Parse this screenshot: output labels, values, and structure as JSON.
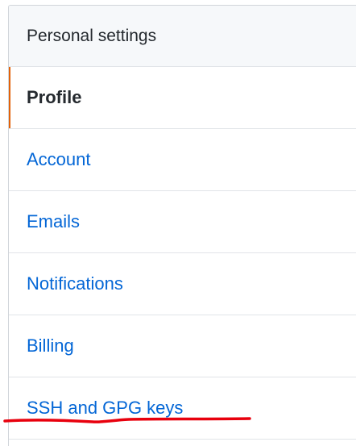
{
  "settings_menu": {
    "heading": "Personal settings",
    "items": [
      {
        "label": "Profile",
        "selected": true
      },
      {
        "label": "Account",
        "selected": false
      },
      {
        "label": "Emails",
        "selected": false
      },
      {
        "label": "Notifications",
        "selected": false
      },
      {
        "label": "Billing",
        "selected": false
      },
      {
        "label": "SSH and GPG keys",
        "selected": false
      }
    ]
  },
  "colors": {
    "link": "#0366d6",
    "selected_accent": "#e36209",
    "annotation": "#e8000d",
    "heading_bg": "#f6f8fa",
    "border": "#d1d5da"
  }
}
